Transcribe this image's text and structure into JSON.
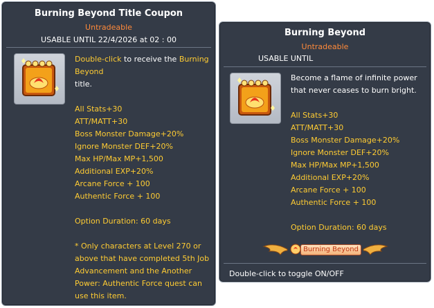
{
  "coupon": {
    "title": "Burning Beyond Title Coupon",
    "tradeable": "Untradeable",
    "usable_until": "USABLE UNTIL 22/4/2026 at 02 : 00",
    "icon": "burning-beyond-coupon-icon",
    "desc_hl1": "Double-click",
    "desc_pl1": " to receive the ",
    "desc_hl2": "Burning Beyond",
    "desc_pl2": "title.",
    "stats": [
      "All Stats+30",
      "ATT/MATT+30",
      "Boss Monster Damage+20%",
      "Ignore Monster DEF+20%",
      "Max HP/Max MP+1,500",
      "Additional EXP+20%",
      "Arcane Force + 100",
      "Authentic Force + 100"
    ],
    "duration": "Option Duration: 60 days",
    "note_lines": [
      "* Only characters at Level 270 or",
      "above that have completed 5th Job",
      "Advancement and the Another",
      "Power: Authentic Force quest can",
      "use this item."
    ]
  },
  "title_item": {
    "title": "Burning Beyond",
    "tradeable": "Untradeable",
    "usable_until": "USABLE UNTIL",
    "icon": "burning-beyond-title-icon",
    "desc_lines": [
      "Become a flame of infinite power",
      "that never ceases to burn bright."
    ],
    "stats": [
      "All Stats+30",
      "ATT/MATT+30",
      "Boss Monster Damage+20%",
      "Ignore Monster DEF+20%",
      "Max HP/Max MP+1,500",
      "Additional EXP+20%",
      "Arcane Force + 100",
      "Authentic Force + 100"
    ],
    "duration": "Option Duration: 60 days",
    "badge_text": "Burning Beyond",
    "footer": "Double-click to toggle ON/OFF"
  },
  "colors": {
    "panel_bg": "#343b47",
    "highlight": "#ffcc33",
    "untradeable": "#ff8a3a",
    "text": "#ffffff"
  }
}
